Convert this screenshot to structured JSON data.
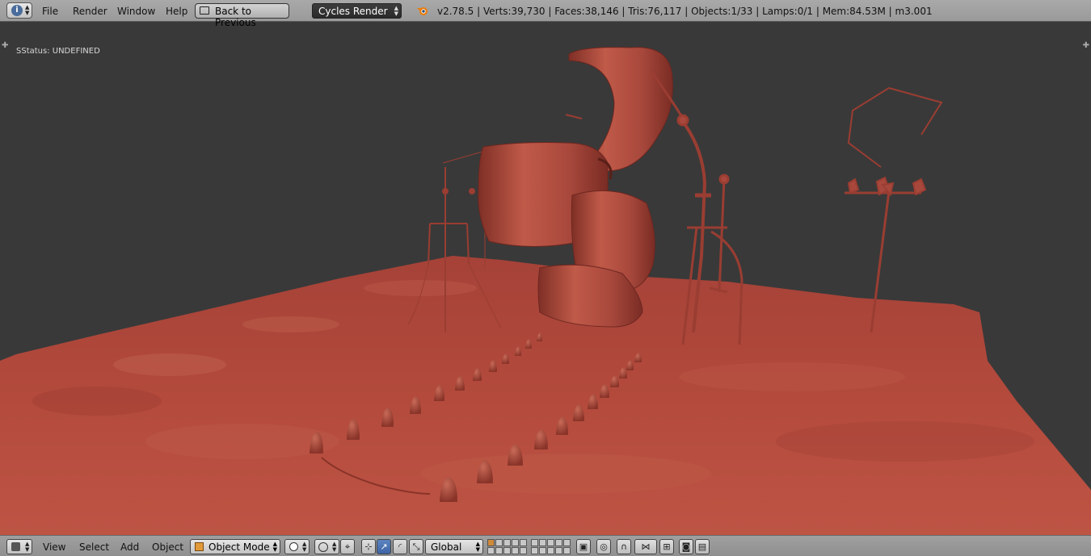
{
  "topbar": {
    "editor_icon": "info-icon",
    "menus": [
      "File",
      "Render",
      "Window",
      "Help"
    ],
    "back_button": "Back to Previous",
    "render_engine": "Cycles Render",
    "stats": "v2.78.5 | Verts:39,730 | Faces:38,146 | Tris:76,117 | Objects:1/33 | Lamps:0/1 | Mem:84.53M | m3.001"
  },
  "viewport": {
    "status": "SStatus: UNDEFINED",
    "colors": {
      "background": "#393939",
      "terrain": "#b34a3c",
      "model": "#a8483c"
    }
  },
  "bottombar": {
    "editor_icon": "3d-view-icon",
    "menus": [
      "View",
      "Select",
      "Add",
      "Object"
    ],
    "mode": "Object Mode",
    "orientation": "Global"
  }
}
